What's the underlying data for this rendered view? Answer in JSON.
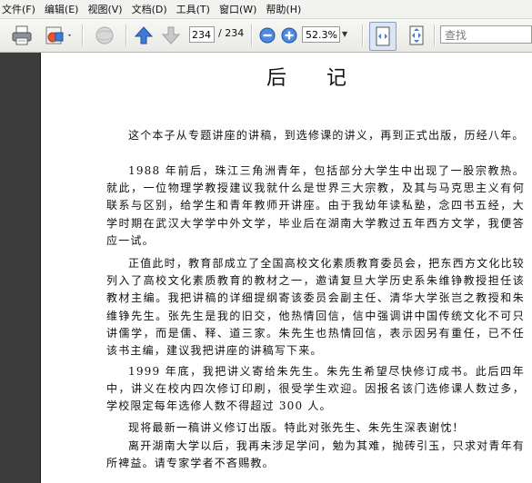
{
  "menu": {
    "items": [
      "文件(F)",
      "编辑(E)",
      "视图(V)",
      "文档(D)",
      "工具(T)",
      "窗口(W)",
      "帮助(H)"
    ]
  },
  "toolbar": {
    "current_page": "234",
    "page_count": "/ 234",
    "zoom": "52.3%",
    "search_placeholder": "查找"
  },
  "document": {
    "title": "后记",
    "paragraphs": [
      "这个本子从专题讲座的讲稿，到选修课的讲义，再到正式出版，历经八年。",
      "1988 年前后，珠江三角洲青年，包括部分大学生中出现了一股宗教热。就此，一位物理学教授建议我就什么是世界三大宗教，及其与马克思主义有何联系与区别，给学生和青年教师开讲座。由于我幼年读私塾，念四书五经，大学时期在武汉大学学中外文学，毕业后在湖南大学教过五年西方文学，我便答应一试。",
      "正值此时，教育部成立了全国高校文化素质教育委员会，把东西方文化比较列入了高校文化素质教育的教材之一，邀请复旦大学历史系朱维铮教授担任该教材主编。我把讲稿的详细提纲寄该委员会副主任、清华大学张岂之教授和朱维铮先生。张先生是我的旧交，他热情回信，信中强调讲中国传统文化不可只讲儒学，而是儒、释、道三家。朱先生也热情回信，表示因另有重任，已不任该书主编，建议我把讲座的讲稿写下来。",
      "1999 年底，我把讲义寄给朱先生。朱先生希望尽快修订成书。此后四年中，讲义在校内四次修订印刷，很受学生欢迎。因报名该门选修课人数过多，学校限定每年选修人数不得超过 300 人。",
      "现将最新一稿讲义修订出版。特此对张先生、朱先生深表谢忱！",
      "离开湖南大学以后，我再未涉足学问，勉为其难，抛砖引玉，只求对青年有所裨益。请专家学者不吝赐教。"
    ]
  }
}
